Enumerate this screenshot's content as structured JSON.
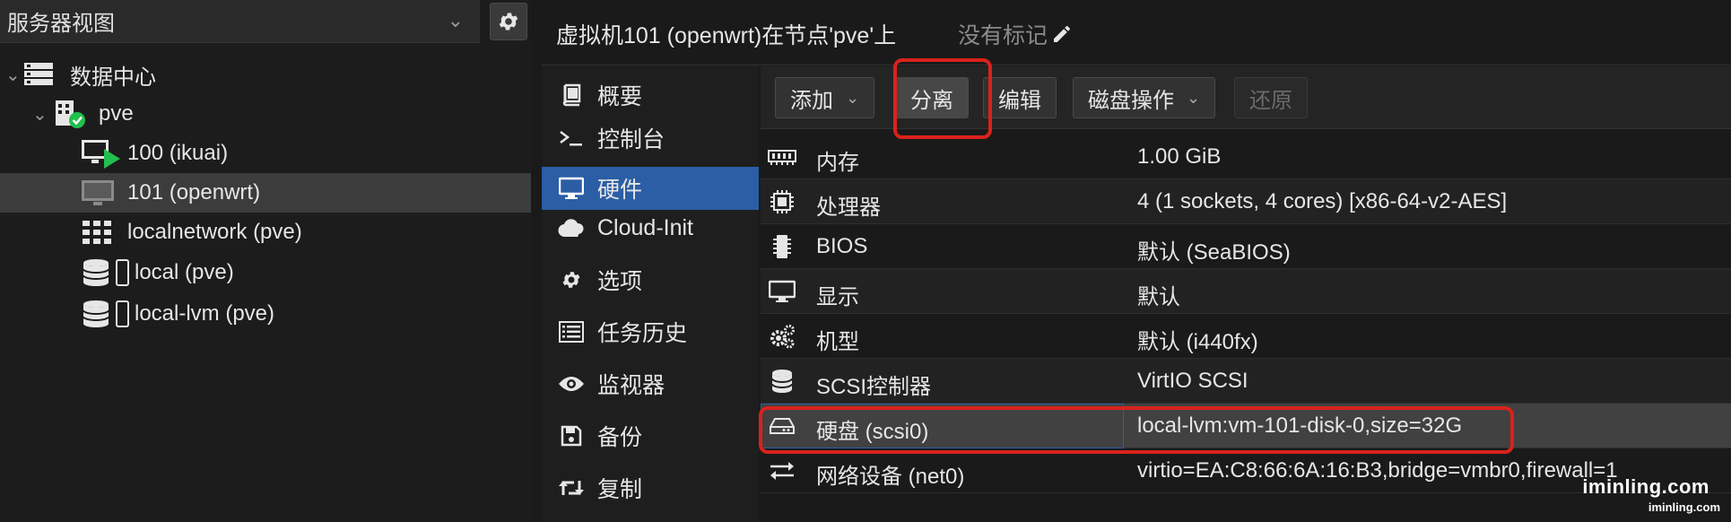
{
  "tree": {
    "view_selector": "服务器视图",
    "items": [
      {
        "label": "数据中心",
        "icon": "datacenter-icon"
      },
      {
        "label": "pve",
        "icon": "node-online-icon"
      },
      {
        "label": "100 (ikuai)",
        "icon": "vm-running-icon"
      },
      {
        "label": "101 (openwrt)",
        "icon": "vm-stopped-icon"
      },
      {
        "label": "localnetwork (pve)",
        "icon": "network-grid-icon"
      },
      {
        "label": "local (pve)",
        "icon": "storage-icon"
      },
      {
        "label": "local-lvm (pve)",
        "icon": "storage-icon"
      }
    ]
  },
  "header": {
    "title": "虚拟机101 (openwrt)在节点'pve'上",
    "tags": "没有标记"
  },
  "nav": {
    "items": [
      {
        "label": "概要",
        "icon": "summary-book-icon"
      },
      {
        "label": "控制台",
        "icon": "console-prompt-icon"
      },
      {
        "label": "硬件",
        "icon": "monitor-icon"
      },
      {
        "label": "Cloud-Init",
        "icon": "cloud-icon"
      },
      {
        "label": "选项",
        "icon": "gear-icon"
      },
      {
        "label": "任务历史",
        "icon": "list-icon"
      },
      {
        "label": "监视器",
        "icon": "eye-icon"
      },
      {
        "label": "备份",
        "icon": "floppy-icon"
      },
      {
        "label": "复制",
        "icon": "retweet-icon"
      }
    ],
    "active": "硬件"
  },
  "toolbar": {
    "add": "添加",
    "detach": "分离",
    "edit": "编辑",
    "disk_action": "磁盘操作",
    "revert": "还原"
  },
  "hardware": [
    {
      "name": "内存",
      "value": "1.00 GiB",
      "icon": "memory-icon"
    },
    {
      "name": "处理器",
      "value": "4 (1 sockets, 4 cores) [x86-64-v2-AES]",
      "icon": "cpu-icon"
    },
    {
      "name": "BIOS",
      "value": "默认 (SeaBIOS)",
      "icon": "microchip-icon"
    },
    {
      "name": "显示",
      "value": "默认",
      "icon": "desktop-icon"
    },
    {
      "name": "机型",
      "value": "默认 (i440fx)",
      "icon": "cogs-icon"
    },
    {
      "name": "SCSI控制器",
      "value": "VirtIO SCSI",
      "icon": "database-icon"
    },
    {
      "name": "硬盘 (scsi0)",
      "value": "local-lvm:vm-101-disk-0,size=32G",
      "icon": "hdd-icon"
    },
    {
      "name": "网络设备 (net0)",
      "value": "virtio=EA:C8:66:6A:16:B3,bridge=vmbr0,firewall=1",
      "icon": "exchange-icon"
    }
  ],
  "selected_hardware": "硬盘 (scsi0)",
  "watermark": {
    "line1": "iminling.com",
    "line2": "iminling.com"
  },
  "colors": {
    "selection_blue": "#2b5ea5",
    "annotation_red": "#d9221c",
    "running_green": "#21bf4b"
  }
}
